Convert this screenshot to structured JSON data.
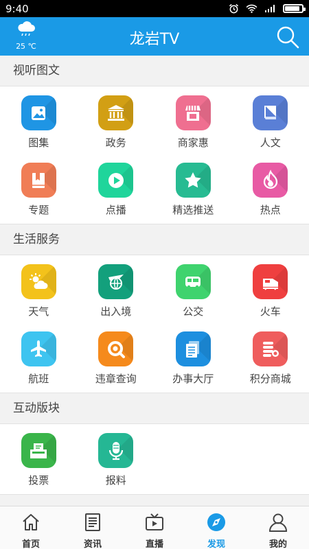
{
  "status_bar": {
    "time": "9:40",
    "battery_level": 0.9
  },
  "app_bar": {
    "title": "龙岩TV",
    "weather_temp": "25 ℃",
    "weather_icon": "rain-cloud-icon"
  },
  "sections": [
    {
      "title": "视听图文",
      "items": [
        {
          "label": "图集",
          "icon": "picture-icon",
          "color": "#1f95e4"
        },
        {
          "label": "政务",
          "icon": "government-building-icon",
          "color": "#d29f14"
        },
        {
          "label": "商家惠",
          "icon": "shop-icon",
          "color": "#ef6f90"
        },
        {
          "label": "人文",
          "icon": "book-icon",
          "color": "#5a7fd6"
        },
        {
          "label": "专题",
          "icon": "bookmark-book-icon",
          "color": "#f07d56"
        },
        {
          "label": "点播",
          "icon": "play-icon",
          "color": "#1fd59b"
        },
        {
          "label": "精选推送",
          "icon": "star-icon",
          "color": "#27bb92"
        },
        {
          "label": "热点",
          "icon": "flame-icon",
          "color": "#e85aa4"
        }
      ]
    },
    {
      "title": "生活服务",
      "items": [
        {
          "label": "天气",
          "icon": "sun-cloud-icon",
          "color": "#f3c21b"
        },
        {
          "label": "出入境",
          "icon": "plane-globe-icon",
          "color": "#13a07c"
        },
        {
          "label": "公交",
          "icon": "bus-icon",
          "color": "#3fd36e"
        },
        {
          "label": "火车",
          "icon": "train-icon",
          "color": "#ef3f3f"
        },
        {
          "label": "航班",
          "icon": "airplane-icon",
          "color": "#3ec4f0"
        },
        {
          "label": "违章查询",
          "icon": "magnifier-icon",
          "color": "#f58a1c"
        },
        {
          "label": "办事大厅",
          "icon": "documents-icon",
          "color": "#1d8fdf"
        },
        {
          "label": "积分商城",
          "icon": "points-list-icon",
          "color": "#ef5d5d"
        }
      ]
    },
    {
      "title": "互动版块",
      "items": [
        {
          "label": "投票",
          "icon": "ballot-box-icon",
          "color": "#3ab54a"
        },
        {
          "label": "报料",
          "icon": "microphone-icon",
          "color": "#25b794"
        }
      ]
    }
  ],
  "bottom_nav": [
    {
      "label": "首页",
      "icon": "home-icon",
      "active": false
    },
    {
      "label": "资讯",
      "icon": "news-icon",
      "active": false
    },
    {
      "label": "直播",
      "icon": "tv-icon",
      "active": false
    },
    {
      "label": "发现",
      "icon": "compass-icon",
      "active": true
    },
    {
      "label": "我的",
      "icon": "user-icon",
      "active": false
    }
  ],
  "colors": {
    "accent": "#1a9ae6",
    "active_nav": "#1a9ae6"
  }
}
